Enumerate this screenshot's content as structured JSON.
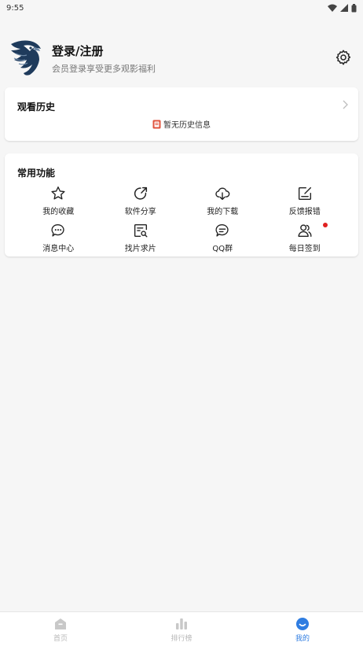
{
  "status_bar": {
    "time": "9:55"
  },
  "profile": {
    "title": "登录/注册",
    "subtitle": "会员登录享受更多观影福利"
  },
  "history": {
    "title": "观看历史",
    "empty_text": "暂无历史信息"
  },
  "functions": {
    "title": "常用功能",
    "items": [
      {
        "label": "我的收藏",
        "icon": "star-icon"
      },
      {
        "label": "软件分享",
        "icon": "share-icon"
      },
      {
        "label": "我的下载",
        "icon": "cloud-download-icon"
      },
      {
        "label": "反馈报错",
        "icon": "edit-note-icon"
      },
      {
        "label": "消息中心",
        "icon": "chat-bubble-icon"
      },
      {
        "label": "找片求片",
        "icon": "search-document-icon"
      },
      {
        "label": "QQ群",
        "icon": "chat-group-icon"
      },
      {
        "label": "每日签到",
        "icon": "users-icon"
      }
    ]
  },
  "bottom_nav": {
    "items": [
      {
        "label": "首页",
        "icon": "home-icon"
      },
      {
        "label": "排行榜",
        "icon": "ranking-icon"
      },
      {
        "label": "我的",
        "icon": "profile-smile-icon",
        "active": true
      }
    ]
  },
  "colors": {
    "accent": "#2f7de1",
    "notification_dot": "#e02020",
    "background": "#f6f6f6"
  }
}
